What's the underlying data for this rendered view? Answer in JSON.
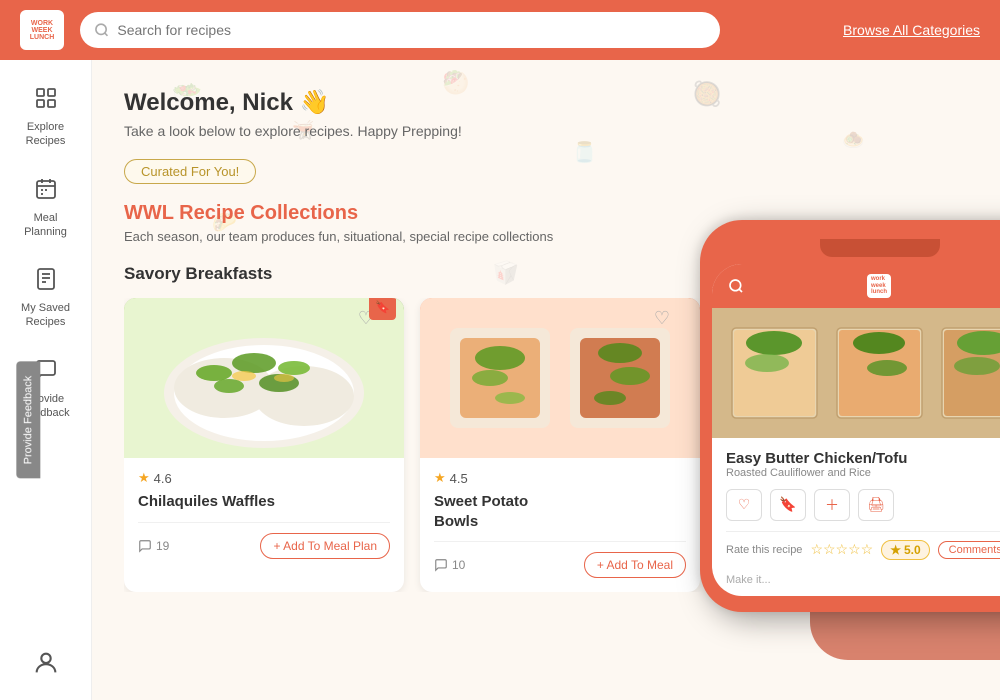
{
  "header": {
    "logo_line1": "work",
    "logo_line2": "week",
    "logo_line3": "lunch",
    "search_placeholder": "Search for recipes",
    "browse_label": "Browse All Categories"
  },
  "sidebar": {
    "items": [
      {
        "id": "explore",
        "label": "Explore\nRecipes",
        "icon": "⊞"
      },
      {
        "id": "meal-planning",
        "label": "Meal\nPlanning",
        "icon": "📅"
      },
      {
        "id": "saved",
        "label": "My Saved\nRecipes",
        "icon": "🔖"
      },
      {
        "id": "feedback",
        "label": "Provide\nFeedback",
        "icon": "💬"
      }
    ]
  },
  "main": {
    "welcome_text": "Welcome, ",
    "username": "Nick",
    "wave_emoji": "👋",
    "tagline": "Take a look below to explore recipes. Happy Prepping!",
    "curated_badge": "Curated For You!",
    "collection_title": "WWL Recipe Collections",
    "collection_desc": "Each season, our team produces fun, situational, special recipe collections",
    "section_title": "Savory Breakfasts",
    "cards": [
      {
        "id": "card1",
        "name": "Chilaquiles Waffles",
        "rating": "4.6",
        "comments": "19",
        "add_label": "+ Add To Meal Plan",
        "img_color": "green"
      },
      {
        "id": "card2",
        "name": "Sweet Potato\nBowls",
        "rating": "4.5",
        "comments": "10",
        "add_label": "+ Add To Meal",
        "img_color": "orange"
      }
    ]
  },
  "phone_overlay": {
    "recipe_name": "Easy Butter Chicken/Tofu",
    "recipe_sub": "Roasted Cauliflower and Rice",
    "rating_label": "Rate this recipe",
    "score": "5.0",
    "comments_label": "Comments",
    "make_label": "Make it...",
    "star_display": "★★★★★",
    "star_empty": "☆☆☆☆☆"
  },
  "feedback_tab": {
    "label": "Provide Feedback"
  }
}
